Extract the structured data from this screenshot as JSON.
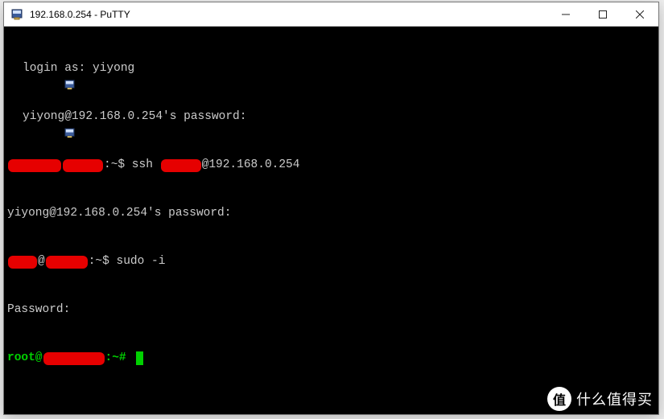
{
  "window": {
    "title": "192.168.0.254 - PuTTY",
    "controls": {
      "minimize": "Minimize",
      "maximize": "Maximize",
      "close": "Close"
    }
  },
  "terminal": {
    "lines": {
      "l1_prefix": "login as: ",
      "l1_val": "yiyong",
      "l2": "yiyong@192.168.0.254's password:",
      "l3_mid": ":~$ ssh ",
      "l3_suffix": "@192.168.0.254",
      "l4": "yiyong@192.168.0.254's password:",
      "l5_at": "@",
      "l5_mid": ":~$ ",
      "l5_cmd": "sudo -i",
      "l6": "Password:",
      "l7_prefix": "root@",
      "l7_mid": ":~# "
    },
    "redactions": {
      "r3a_w": 66,
      "r3b_w": 50,
      "r3c_w": 50,
      "r5a_w": 36,
      "r5b_w": 52,
      "r7_w": 76
    }
  },
  "watermark": {
    "badge": "值",
    "text": "什么值得买"
  }
}
